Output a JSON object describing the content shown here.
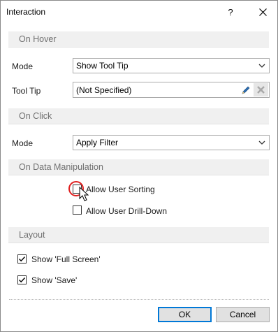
{
  "window": {
    "title": "Interaction",
    "help_glyph": "?",
    "close_glyph": "✕"
  },
  "on_hover": {
    "header": "On Hover",
    "mode_label": "Mode",
    "mode_value": "Show Tool Tip",
    "tooltip_label": "Tool Tip",
    "tooltip_value": "(Not Specified)"
  },
  "on_click": {
    "header": "On Click",
    "mode_label": "Mode",
    "mode_value": "Apply Filter"
  },
  "on_data_manipulation": {
    "header": "On Data Manipulation",
    "allow_user_sorting": {
      "label": "Allow User Sorting",
      "checked": false
    },
    "allow_user_drilldown": {
      "label": "Allow User Drill-Down",
      "checked": false
    }
  },
  "layout": {
    "header": "Layout",
    "show_full_screen": {
      "label": "Show 'Full Screen'",
      "checked": true
    },
    "show_save": {
      "label": "Show 'Save'",
      "checked": true
    }
  },
  "buttons": {
    "ok": "OK",
    "cancel": "Cancel"
  },
  "colors": {
    "section_bg": "#f0f0f0",
    "section_text": "#707070",
    "highlight_ring": "#e02020",
    "default_button_border": "#0078d7",
    "edit_icon": "#2b6cb0"
  }
}
